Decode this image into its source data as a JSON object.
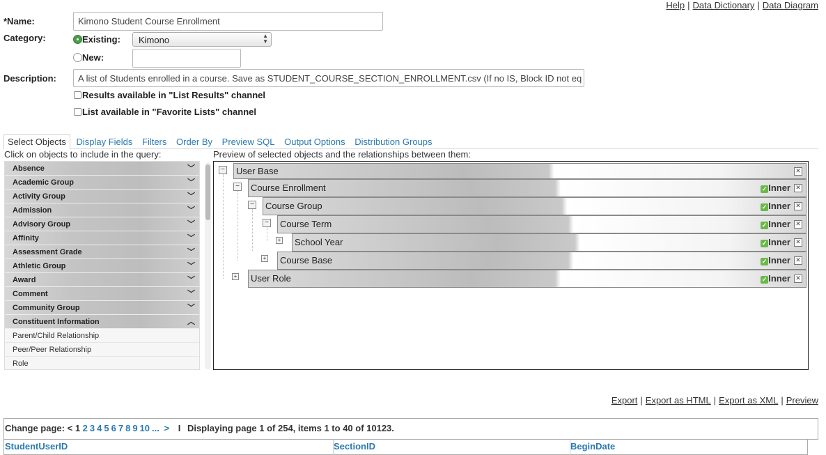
{
  "header_links": {
    "help": "Help",
    "data_dictionary": "Data Dictionary",
    "data_diagram": "Data Diagram",
    "separator": "|"
  },
  "form": {
    "name_label": "*Name:",
    "name_value": "Kimono Student Course Enrollment",
    "category_label": "Category:",
    "existing_label": "Existing:",
    "existing_value": "Kimono",
    "new_label": "New:",
    "new_value": "",
    "description_label": "Description:",
    "description_value": "A list of Students enrolled in a course. Save as STUDENT_COURSE_SECTION_ENROLLMENT.csv (If no IS, Block ID not eq",
    "results_channel_label": "Results available in \"List Results\" channel",
    "favorites_channel_label": "List available in \"Favorite Lists\" channel"
  },
  "tabs": [
    {
      "label": "Select Objects",
      "active": true
    },
    {
      "label": "Display Fields",
      "active": false
    },
    {
      "label": "Filters",
      "active": false
    },
    {
      "label": "Order By",
      "active": false
    },
    {
      "label": "Preview SQL",
      "active": false
    },
    {
      "label": "Output Options",
      "active": false
    },
    {
      "label": "Distribution Groups",
      "active": false
    }
  ],
  "objects_caption": "Click on objects to include in the query:",
  "preview_caption": "Preview of selected objects and the relationships between them:",
  "objects": [
    {
      "label": "Absence",
      "icon": "chevron-down-icon"
    },
    {
      "label": "Academic Group",
      "icon": "chevron-down-icon"
    },
    {
      "label": "Activity Group",
      "icon": "chevron-down-icon"
    },
    {
      "label": "Admission",
      "icon": "chevron-down-icon"
    },
    {
      "label": "Advisory Group",
      "icon": "chevron-down-icon"
    },
    {
      "label": "Affinity",
      "icon": "chevron-down-icon"
    },
    {
      "label": "Assessment Grade",
      "icon": "chevron-down-icon"
    },
    {
      "label": "Athletic Group",
      "icon": "chevron-down-icon"
    },
    {
      "label": "Award",
      "icon": "chevron-down-icon"
    },
    {
      "label": "Comment",
      "icon": "chevron-down-icon"
    },
    {
      "label": "Community Group",
      "icon": "chevron-down-icon"
    },
    {
      "label": "Constituent Information",
      "icon": "chevron-up-icon"
    }
  ],
  "sub_objects": [
    "Parent/Child Relationship",
    "Peer/Peer Relationship",
    "Role"
  ],
  "tree": {
    "inner_label": "Inner",
    "nodes": [
      "User Base",
      "Course Enrollment",
      "Course Group",
      "Course Term",
      "School Year",
      "Course Base",
      "User Role"
    ],
    "expander_minus": "−",
    "expander_plus": "+",
    "remove_glyph": "✕",
    "check_glyph": "✓"
  },
  "export_links": {
    "export": "Export",
    "export_html": "Export as HTML",
    "export_xml": "Export as XML",
    "preview": "Preview",
    "separator": "|"
  },
  "pager": {
    "change_page": "Change page:",
    "prev": "<",
    "current": "1",
    "pages": [
      "2",
      "3",
      "4",
      "5",
      "6",
      "7",
      "8",
      "9",
      "10",
      "..."
    ],
    "next": ">",
    "separator": "I",
    "status": "Displaying page 1 of 254, items 1 to 40 of 10123."
  },
  "results_columns": [
    "StudentUserID",
    "SectionID",
    "BeginDate"
  ],
  "colors": {
    "link": "#2a7ab0",
    "check_green": "#6cb84b",
    "radio_green": "#4a9d4a"
  }
}
